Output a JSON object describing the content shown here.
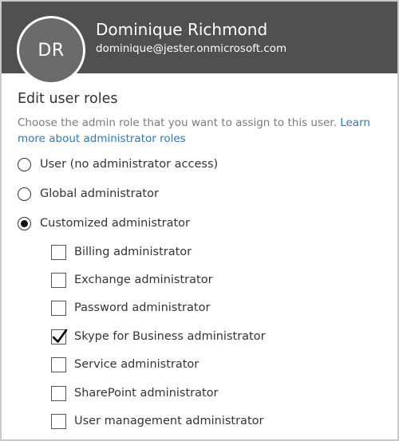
{
  "user": {
    "initials": "DR",
    "name": "Dominique Richmond",
    "email": "dominique@jester.onmicrosoft.com"
  },
  "section": {
    "title": "Edit user roles",
    "description": "Choose the admin role that you want to assign to this user. ",
    "link_text": "Learn more about administrator roles"
  },
  "roles": [
    {
      "label": "User (no administrator access)",
      "selected": false
    },
    {
      "label": "Global administrator",
      "selected": false
    },
    {
      "label": "Customized administrator",
      "selected": true
    }
  ],
  "custom_roles": [
    {
      "label": "Billing administrator",
      "checked": false
    },
    {
      "label": "Exchange administrator",
      "checked": false
    },
    {
      "label": "Password administrator",
      "checked": false
    },
    {
      "label": "Skype for Business administrator",
      "checked": true
    },
    {
      "label": "Service administrator",
      "checked": false
    },
    {
      "label": "SharePoint administrator",
      "checked": false
    },
    {
      "label": "User management administrator",
      "checked": false
    }
  ],
  "colors": {
    "header_bg": "#505050",
    "link": "#2b78c4"
  }
}
